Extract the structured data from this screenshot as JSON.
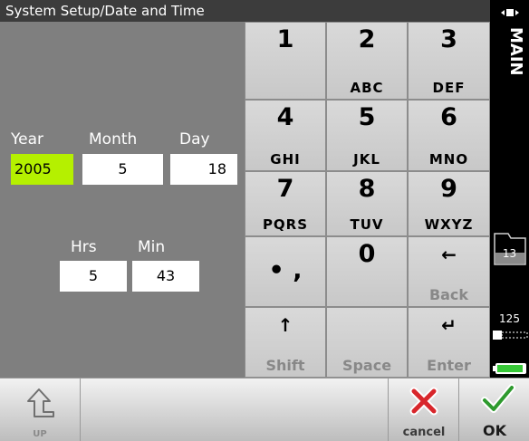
{
  "window": {
    "title": "System Setup/Date and Time"
  },
  "date": {
    "year_label": "Year",
    "month_label": "Month",
    "day_label": "Day",
    "year": "2005",
    "month": "5",
    "day": "18"
  },
  "time": {
    "hrs_label": "Hrs",
    "min_label": "Min",
    "hrs": "5",
    "min": "43"
  },
  "keypad": {
    "k1": {
      "main": "1",
      "sub": ""
    },
    "k2": {
      "main": "2",
      "sub": "ABC"
    },
    "k3": {
      "main": "3",
      "sub": "DEF"
    },
    "k4": {
      "main": "4",
      "sub": "GHI"
    },
    "k5": {
      "main": "5",
      "sub": "JKL"
    },
    "k6": {
      "main": "6",
      "sub": "MNO"
    },
    "k7": {
      "main": "7",
      "sub": "PQRS"
    },
    "k8": {
      "main": "8",
      "sub": "TUV"
    },
    "k9": {
      "main": "9",
      "sub": "WXYZ"
    },
    "punct": {
      "main": "• ,",
      "sub": ""
    },
    "k0": {
      "main": "0",
      "sub": ""
    },
    "back": {
      "sub": "Back",
      "icon": "left-arrow-icon"
    },
    "shift": {
      "sub": "Shift",
      "icon": "up-arrow-icon"
    },
    "space": {
      "sub": "Space"
    },
    "enter": {
      "sub": "Enter",
      "icon": "enter-arrow-icon"
    }
  },
  "sidebar": {
    "main_label": "MAIN",
    "folder_count": "13",
    "battery_value": "125"
  },
  "bottom": {
    "up_label": "UP",
    "cancel_label": "cancel",
    "ok_label": "OK"
  },
  "colors": {
    "active_field": "#b5f000",
    "background": "#7f7f7f",
    "titlebar": "#3c3c3c"
  }
}
